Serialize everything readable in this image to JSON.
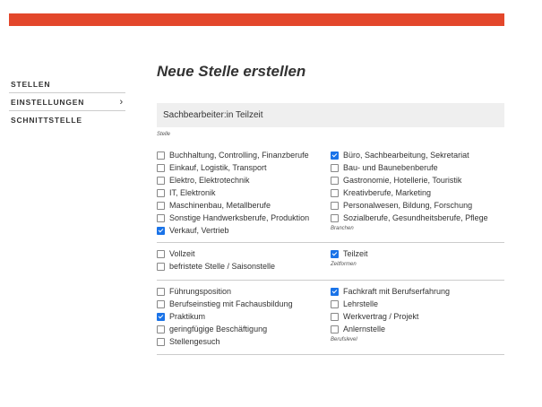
{
  "nav": {
    "items": [
      {
        "label": "STELLEN",
        "chevron": false
      },
      {
        "label": "EINSTELLUNGEN",
        "chevron": true
      },
      {
        "label": "SCHNITTSTELLE",
        "chevron": false
      }
    ]
  },
  "form": {
    "heading": "Neue Stelle erstellen",
    "title_value": "Sachbearbeiter:in Teilzeit",
    "title_label": "Stelle"
  },
  "sections": [
    {
      "label": "Branchen",
      "left": [
        {
          "label": "Buchhaltung, Controlling, Finanzberufe",
          "checked": false
        },
        {
          "label": "Einkauf, Logistik, Transport",
          "checked": false
        },
        {
          "label": "Elektro, Elektrotechnik",
          "checked": false
        },
        {
          "label": "IT, Elektronik",
          "checked": false
        },
        {
          "label": "Maschinenbau, Metallberufe",
          "checked": false
        },
        {
          "label": "Sonstige Handwerksberufe, Produktion",
          "checked": false
        },
        {
          "label": "Verkauf, Vertrieb",
          "checked": true
        }
      ],
      "right": [
        {
          "label": "Büro, Sachbearbeitung, Sekretariat",
          "checked": true
        },
        {
          "label": "Bau- und Baunebenberufe",
          "checked": false
        },
        {
          "label": "Gastronomie, Hotellerie, Touristik",
          "checked": false
        },
        {
          "label": "Kreativberufe, Marketing",
          "checked": false
        },
        {
          "label": "Personalwesen, Bildung, Forschung",
          "checked": false
        },
        {
          "label": "Sozialberufe, Gesundheitsberufe, Pflege",
          "checked": false
        }
      ]
    },
    {
      "label": "Zeitformen",
      "left": [
        {
          "label": "Vollzeit",
          "checked": false
        },
        {
          "label": "befristete Stelle / Saisonstelle",
          "checked": false
        }
      ],
      "right": [
        {
          "label": "Teilzeit",
          "checked": true
        }
      ]
    },
    {
      "label": "Berufslevel",
      "left": [
        {
          "label": "Führungsposition",
          "checked": false
        },
        {
          "label": "Berufseinstieg mit Fachausbildung",
          "checked": false
        },
        {
          "label": "Praktikum",
          "checked": true
        },
        {
          "label": "geringfügige Beschäftigung",
          "checked": false
        },
        {
          "label": "Stellengesuch",
          "checked": false
        }
      ],
      "right": [
        {
          "label": "Fachkraft mit Berufserfahrung",
          "checked": true
        },
        {
          "label": "Lehrstelle",
          "checked": false
        },
        {
          "label": "Werkvertrag / Projekt",
          "checked": false
        },
        {
          "label": "Anlernstelle",
          "checked": false
        }
      ]
    }
  ]
}
